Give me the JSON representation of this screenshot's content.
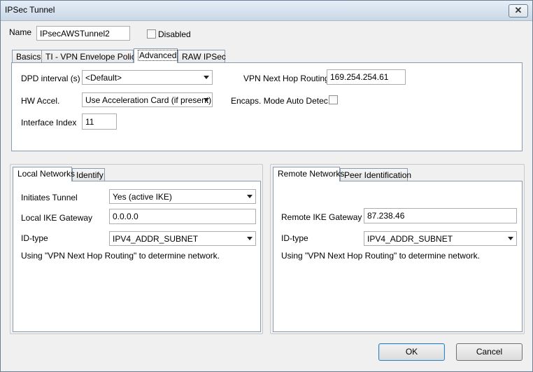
{
  "window": {
    "title": "IPSec Tunnel",
    "close_glyph": "✕"
  },
  "header": {
    "name_label": "Name",
    "name_value": "IPsecAWSTunnel2",
    "disabled_label": "Disabled",
    "disabled_checked": false
  },
  "top_tabs": [
    {
      "label": "Basics",
      "active": false
    },
    {
      "label": "TI - VPN Envelope Policy",
      "active": false
    },
    {
      "label": "Advanced",
      "active": true
    },
    {
      "label": "RAW IPSec",
      "active": false
    }
  ],
  "advanced": {
    "dpd_label": "DPD interval (s)",
    "dpd_value": "<Default>",
    "hw_label": "HW Accel.",
    "hw_value": "Use Acceleration Card (if present)",
    "ifindex_label": "Interface Index",
    "ifindex_value": "11",
    "nexthop_label": "VPN Next Hop Routing",
    "nexthop_value": "169.254.254.61",
    "encaps_label": "Encaps. Mode Auto Detec.",
    "encaps_checked": false
  },
  "local": {
    "tabs": [
      {
        "label": "Local Networks",
        "active": true
      },
      {
        "label": "Identify",
        "active": false
      }
    ],
    "initiates_label": "Initiates Tunnel",
    "initiates_value": "Yes (active IKE)",
    "gateway_label": "Local IKE Gateway",
    "gateway_value": "0.0.0.0",
    "idtype_label": "ID-type",
    "idtype_value": "IPV4_ADDR_SUBNET",
    "note": "Using \"VPN Next Hop Routing\" to determine network."
  },
  "remote": {
    "tabs": [
      {
        "label": "Remote Networks",
        "active": true
      },
      {
        "label": "Peer Identification",
        "active": false
      }
    ],
    "gateway_label": "Remote IKE Gateway",
    "gateway_value": "87.238.46",
    "idtype_label": "ID-type",
    "idtype_value": "IPV4_ADDR_SUBNET",
    "note": "Using \"VPN Next Hop Routing\" to determine network."
  },
  "footer": {
    "ok_label": "OK",
    "cancel_label": "Cancel"
  }
}
